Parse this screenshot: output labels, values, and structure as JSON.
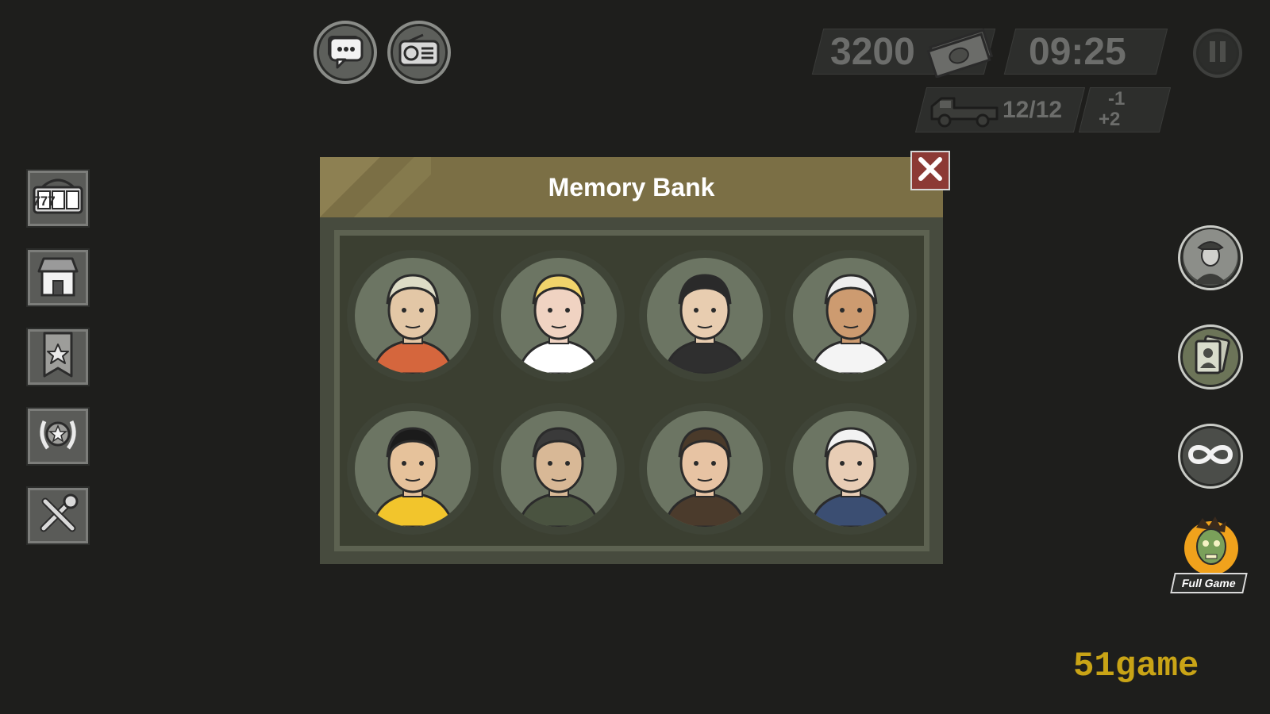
{
  "hud": {
    "money": "3200",
    "time": "09:25",
    "truck_capacity": "12/12",
    "delta_minus": "-1",
    "delta_plus": "+2"
  },
  "top_buttons": [
    {
      "name": "chat",
      "icon": "chat-bubbles-icon"
    },
    {
      "name": "radio",
      "icon": "radio-icon"
    }
  ],
  "left_menu": [
    {
      "name": "slot-machine",
      "icon": "slot-777-icon",
      "label": "777"
    },
    {
      "name": "shop",
      "icon": "store-icon"
    },
    {
      "name": "ranks",
      "icon": "ribbon-star-icon"
    },
    {
      "name": "achievements",
      "icon": "laurel-star-icon"
    },
    {
      "name": "settings",
      "icon": "tools-icon"
    }
  ],
  "right_menu": [
    {
      "name": "officer",
      "icon": "officer-portrait-icon"
    },
    {
      "name": "cards",
      "icon": "character-cards-icon"
    },
    {
      "name": "endless",
      "icon": "infinity-icon"
    }
  ],
  "full_game": {
    "label": "Full Game",
    "icon": "zombie-icon"
  },
  "modal": {
    "title": "Memory Bank",
    "portraits": [
      {
        "icon": "pilot-helmet-portrait-icon",
        "skin": "#e3c7a6",
        "hair": "#dedcc6",
        "clothes": "#d5663d"
      },
      {
        "icon": "blonde-actress-portrait-icon",
        "skin": "#f0d3c2",
        "hair": "#f0d36b",
        "clothes": "#ffffff"
      },
      {
        "icon": "bearded-president-portrait-icon",
        "skin": "#e8cdb0",
        "hair": "#2a2a2a",
        "clothes": "#2f2f2f"
      },
      {
        "icon": "bald-glasses-portrait-icon",
        "skin": "#cd9b70",
        "hair": "#eeeeee",
        "clothes": "#f4f4f4"
      },
      {
        "icon": "martial-artist-portrait-icon",
        "skin": "#e6c29b",
        "hair": "#1b1b1b",
        "clothes": "#f2c52c"
      },
      {
        "icon": "beret-revolutionary-portrait-icon",
        "skin": "#d8b896",
        "hair": "#3a3a3a",
        "clothes": "#4a5340"
      },
      {
        "icon": "cigar-statesman-portrait-icon",
        "skin": "#e7c3a3",
        "hair": "#4a3a2a",
        "clothes": "#4b3b2c"
      },
      {
        "icon": "white-haired-scientist-portrait-icon",
        "skin": "#e8cdb5",
        "hair": "#f2f2f2",
        "clothes": "#3b4e72"
      }
    ]
  },
  "watermark": "51game",
  "colors": {
    "modal_header": "#7b6f45",
    "close_button": "#8c3a35",
    "watermark": "#c9a416"
  }
}
